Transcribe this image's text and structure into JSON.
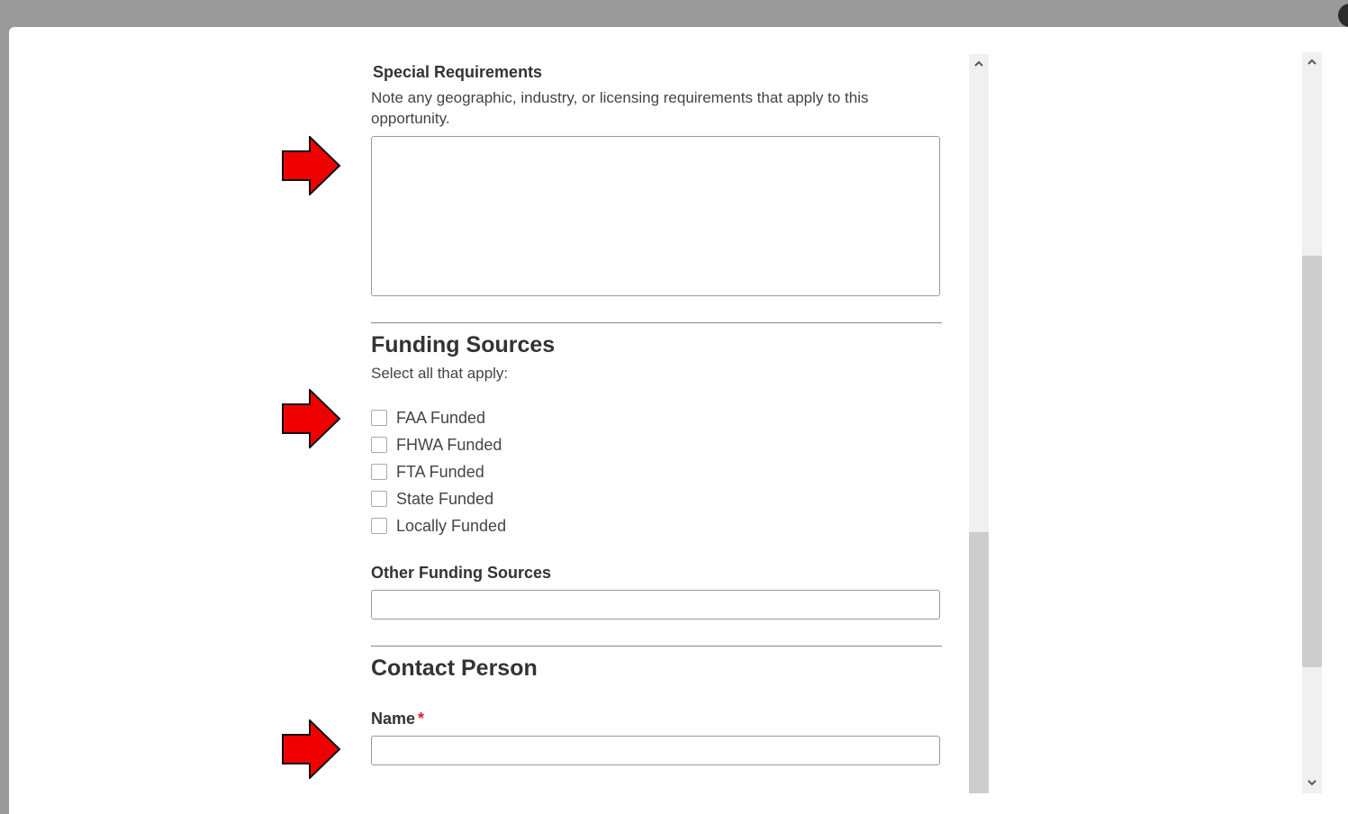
{
  "special_requirements": {
    "label": "Special Requirements",
    "help_text": "Note any geographic, industry, or licensing requirements that apply to this opportunity.",
    "value": ""
  },
  "funding_sources": {
    "heading": "Funding Sources",
    "instruction": "Select all that apply:",
    "options": [
      {
        "label": "FAA Funded",
        "checked": false
      },
      {
        "label": "FHWA Funded",
        "checked": false
      },
      {
        "label": "FTA Funded",
        "checked": false
      },
      {
        "label": "State Funded",
        "checked": false
      },
      {
        "label": "Locally Funded",
        "checked": false
      }
    ],
    "other_label": "Other Funding Sources",
    "other_value": ""
  },
  "contact_person": {
    "heading": "Contact Person",
    "name_label": "Name",
    "required_marker": "*",
    "name_value": ""
  },
  "colors": {
    "overlay": "#9a9a9a",
    "arrow_fill": "#ee0000",
    "required": "#d9251d"
  },
  "icons": {
    "annotation": "red-right-arrow",
    "scroll_up": "chevron-up-icon",
    "scroll_down": "chevron-down-icon"
  }
}
